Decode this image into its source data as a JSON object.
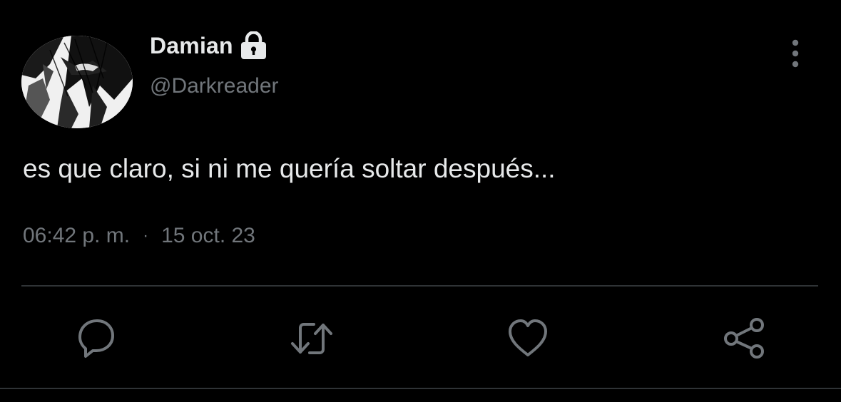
{
  "tweet": {
    "display_name": "Damian",
    "handle": "@Darkreader",
    "text": "es que claro, si ni me quería soltar después...",
    "time": "06:42 p. m.",
    "separator": "·",
    "date": "15 oct. 23",
    "protected": true
  },
  "icons": {
    "lock": "lock-icon",
    "more": "more-vertical-icon",
    "reply": "reply-bubble-icon",
    "retweet": "retweet-icon",
    "like": "heart-icon",
    "share": "share-icon"
  },
  "colors": {
    "background": "#000000",
    "primary_text": "#e7e9ea",
    "secondary_text": "#71767b",
    "divider": "#2f3336"
  }
}
